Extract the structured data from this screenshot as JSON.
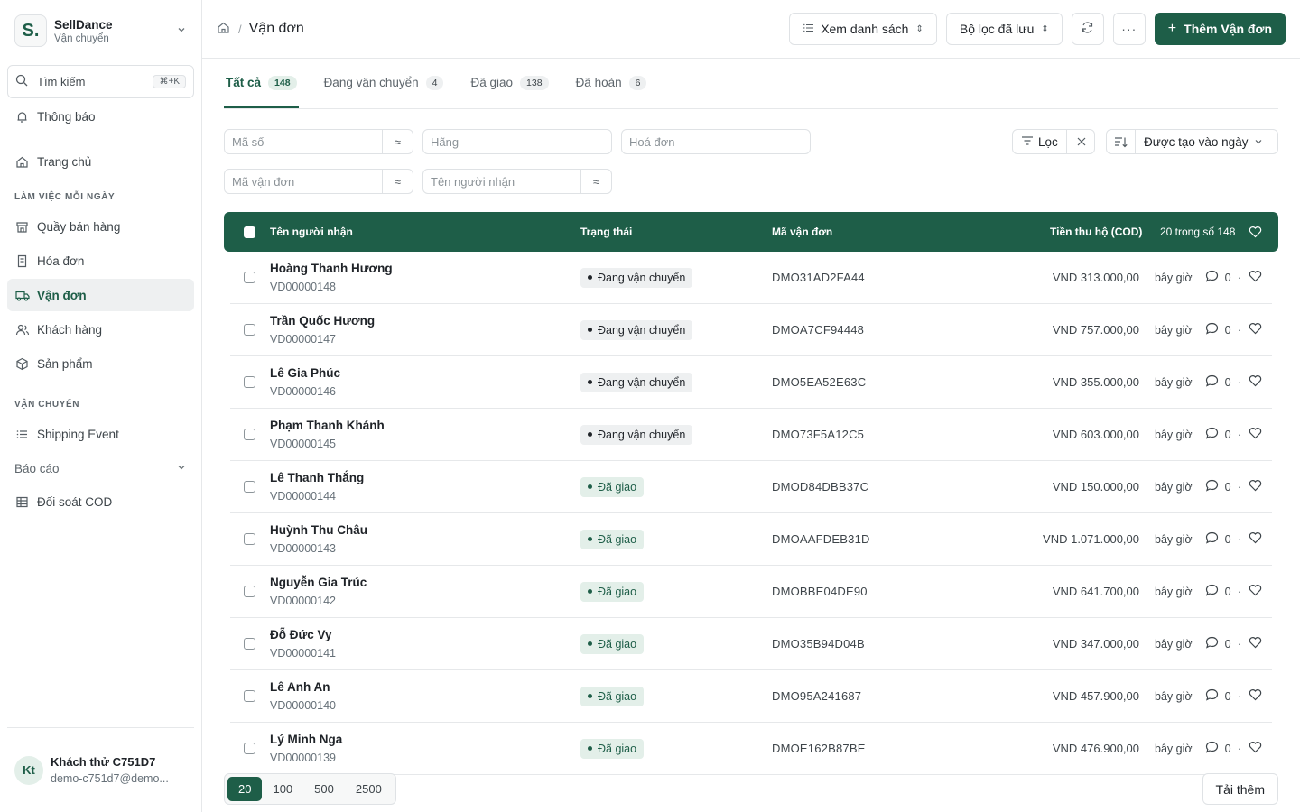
{
  "brand": {
    "logo": "S.",
    "name": "SellDance",
    "subtitle": "Vận chuyển"
  },
  "sidebar": {
    "search_label": "Tìm kiếm",
    "search_shortcut": "⌘+K",
    "notifications": "Thông báo",
    "home": "Trang chủ",
    "section_daily": "LÀM VIỆC MỖI NGÀY",
    "daily_items": [
      "Quầy bán hàng",
      "Hóa đơn",
      "Vận đơn",
      "Khách hàng",
      "Sản phẩm"
    ],
    "section_shipping": "VẬN CHUYỂN",
    "shipping_event": "Shipping Event",
    "reports": "Báo cáo",
    "cod_reconcile": "Đối soát COD"
  },
  "user": {
    "initials": "Kt",
    "name": "Khách thử C751D7",
    "email": "demo-c751d7@demo..."
  },
  "header": {
    "breadcrumb": "Vận đơn",
    "view_list": "Xem danh sách",
    "saved_filters": "Bộ lọc đã lưu",
    "add_button": "Thêm Vận đơn"
  },
  "tabs": [
    {
      "label": "Tất cả",
      "count": "148"
    },
    {
      "label": "Đang vận chuyển",
      "count": "4"
    },
    {
      "label": "Đã giao",
      "count": "138"
    },
    {
      "label": "Đã hoàn",
      "count": "6"
    }
  ],
  "filters": {
    "ma_so": "Mã số",
    "hang": "Hãng",
    "hoa_don": "Hoá đơn",
    "ma_van_don": "Mã vận đơn",
    "ten_nguoi_nhan": "Tên người nhận",
    "op_symbol": "≈",
    "filter_button": "Lọc",
    "sort_label": "Được tạo vào ngày"
  },
  "table": {
    "col_name": "Tên người nhận",
    "col_status": "Trạng thái",
    "col_code": "Mã vận đơn",
    "col_cod": "Tiền thu hộ (COD)",
    "range_text": "20 trong số 148",
    "rows": [
      {
        "name": "Hoàng Thanh Hương",
        "id": "VD00000148",
        "status": "Đang vận chuyển",
        "done": false,
        "code": "DMO31AD2FA44",
        "amount": "VND 313.000,00",
        "time": "bây giờ",
        "comments": "0"
      },
      {
        "name": "Trần Quốc Hương",
        "id": "VD00000147",
        "status": "Đang vận chuyển",
        "done": false,
        "code": "DMOA7CF94448",
        "amount": "VND 757.000,00",
        "time": "bây giờ",
        "comments": "0"
      },
      {
        "name": "Lê Gia Phúc",
        "id": "VD00000146",
        "status": "Đang vận chuyển",
        "done": false,
        "code": "DMO5EA52E63C",
        "amount": "VND 355.000,00",
        "time": "bây giờ",
        "comments": "0"
      },
      {
        "name": "Phạm Thanh Khánh",
        "id": "VD00000145",
        "status": "Đang vận chuyển",
        "done": false,
        "code": "DMO73F5A12C5",
        "amount": "VND 603.000,00",
        "time": "bây giờ",
        "comments": "0"
      },
      {
        "name": "Lê Thanh Thắng",
        "id": "VD00000144",
        "status": "Đã giao",
        "done": true,
        "code": "DMOD84DBB37C",
        "amount": "VND 150.000,00",
        "time": "bây giờ",
        "comments": "0"
      },
      {
        "name": "Huỳnh Thu Châu",
        "id": "VD00000143",
        "status": "Đã giao",
        "done": true,
        "code": "DMOAAFDEB31D",
        "amount": "VND 1.071.000,00",
        "time": "bây giờ",
        "comments": "0"
      },
      {
        "name": "Nguyễn Gia Trúc",
        "id": "VD00000142",
        "status": "Đã giao",
        "done": true,
        "code": "DMOBBE04DE90",
        "amount": "VND 641.700,00",
        "time": "bây giờ",
        "comments": "0"
      },
      {
        "name": "Đỗ Đức Vy",
        "id": "VD00000141",
        "status": "Đã giao",
        "done": true,
        "code": "DMO35B94D04B",
        "amount": "VND 347.000,00",
        "time": "bây giờ",
        "comments": "0"
      },
      {
        "name": "Lê Anh An",
        "id": "VD00000140",
        "status": "Đã giao",
        "done": true,
        "code": "DMO95A241687",
        "amount": "VND 457.900,00",
        "time": "bây giờ",
        "comments": "0"
      },
      {
        "name": "Lý Minh Nga",
        "id": "VD00000139",
        "status": "Đã giao",
        "done": true,
        "code": "DMOE162B87BE",
        "amount": "VND 476.900,00",
        "time": "bây giờ",
        "comments": "0"
      }
    ]
  },
  "pager": {
    "sizes": [
      "20",
      "100",
      "500",
      "2500"
    ],
    "active": "20"
  },
  "load_more": "Tải thêm",
  "colors": {
    "primary": "#1e5e48",
    "border": "#dfe2e5"
  }
}
